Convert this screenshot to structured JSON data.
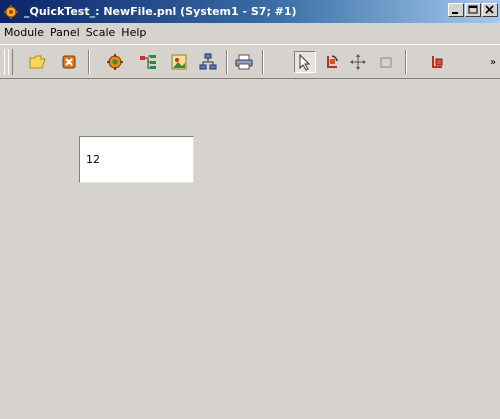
{
  "window": {
    "title": "_QuickTest_: NewFile.pnl (System1 - S7; #1)",
    "minimize_label": "_",
    "restore_label": "□",
    "close_label": "×"
  },
  "menu": [
    {
      "label": "Module"
    },
    {
      "label": "Panel"
    },
    {
      "label": "Scale"
    },
    {
      "label": "Help"
    }
  ],
  "toolbar": {
    "overflow_label": "»",
    "buttons": [
      {
        "icon": "open-folder-icon"
      },
      {
        "icon": "close-panel-icon"
      },
      {
        "icon": "gear-settings-icon"
      },
      {
        "icon": "module-tree-icon"
      },
      {
        "icon": "image-icon"
      },
      {
        "icon": "network-icon"
      },
      {
        "icon": "print-icon"
      },
      {
        "icon": "select-arrow-icon",
        "pressed": true
      },
      {
        "icon": "rotate-icon"
      },
      {
        "icon": "move-icon"
      },
      {
        "icon": "rectangle-icon"
      },
      {
        "icon": "scale-icon"
      }
    ]
  },
  "panel": {
    "text_field_value": "12"
  },
  "colors": {
    "title_start": "#0a246a",
    "title_end": "#a6caf0",
    "background": "#d6d3ce"
  }
}
